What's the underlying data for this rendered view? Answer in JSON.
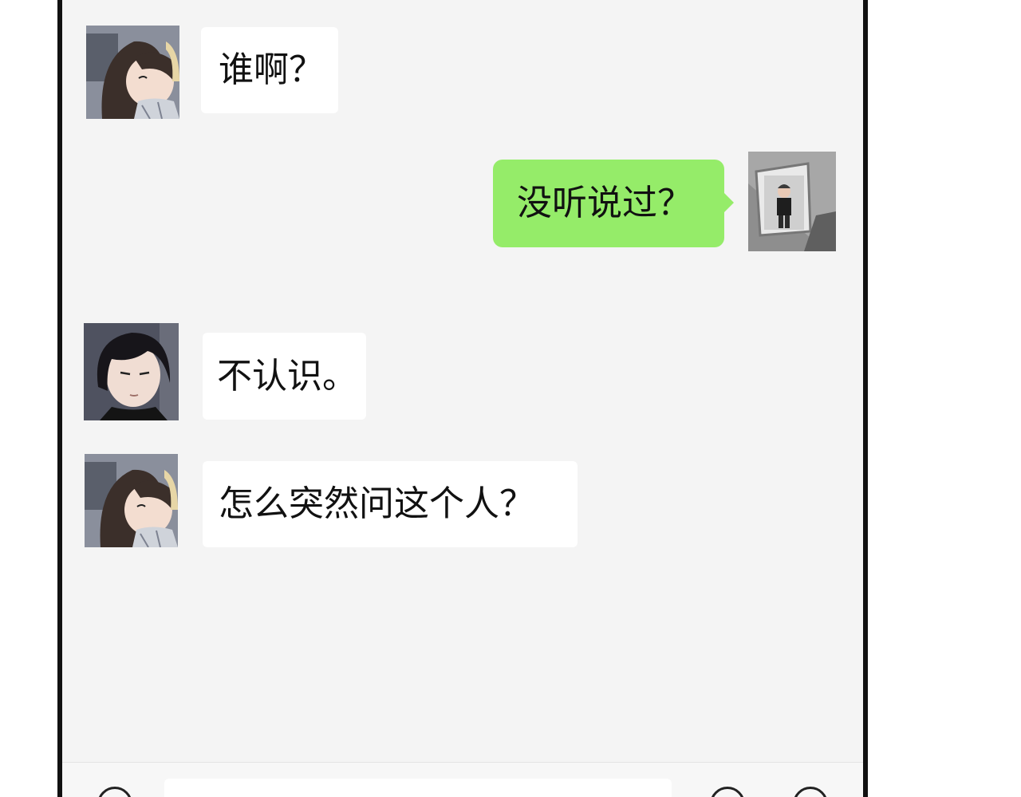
{
  "messages": [
    {
      "side": "left",
      "avatar": "girl-long-hair-avatar",
      "text": "谁啊？"
    },
    {
      "side": "right",
      "avatar": "boy-photo-avatar",
      "text": "没听说过？"
    },
    {
      "side": "left",
      "avatar": "man-dark-hair-avatar",
      "text": "不认识。"
    },
    {
      "side": "left",
      "avatar": "girl-long-hair-avatar",
      "text": "怎么突然问这个人？"
    }
  ],
  "colors": {
    "chat_background": "#f4f4f4",
    "outgoing_bubble": "#95ec69",
    "incoming_bubble": "#ffffff",
    "frame": "#111111"
  }
}
